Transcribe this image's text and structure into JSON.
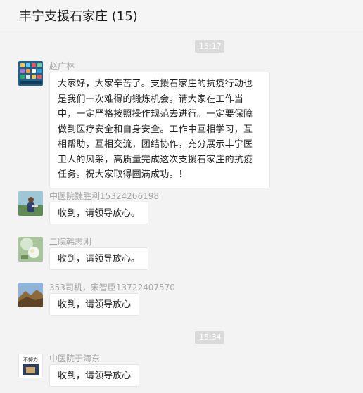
{
  "header": {
    "title": "丰宁支援石家庄 (15)"
  },
  "timestamps": [
    "15:17",
    "15:34"
  ],
  "messages": [
    {
      "sender": "赵广林",
      "text": "大家好，大家辛苦了。支援石家庄的抗疫行动也是我们一次难得的锻炼机会。请大家在工作当中，一定严格按照操作规范去进行。一定要保障做到医疗安全和自身安全。工作中互相学习，互相帮助，互相交流，团结协作，充分展示丰宁医卫人的风采，高质量完成这次支援石家庄的抗疫任务。祝大家取得圆满成功。！"
    },
    {
      "sender": "中医院魏胜利15324266198",
      "text": "收到，请领导放心。"
    },
    {
      "sender": "二院韩志刚",
      "text": "收到，请领导放心。"
    },
    {
      "sender": "353司机，宋智臣13722407570",
      "text": "收到，请领导放心"
    },
    {
      "sender": "中医院于海东",
      "text": "收到，请领导放心"
    }
  ],
  "avatar_labels": {
    "slogan": "不努力"
  },
  "colors": {
    "background": "#f3f3f3",
    "bubble": "#ffffff",
    "time_pill": "#dadada",
    "sender_name": "#a6a6a6"
  }
}
